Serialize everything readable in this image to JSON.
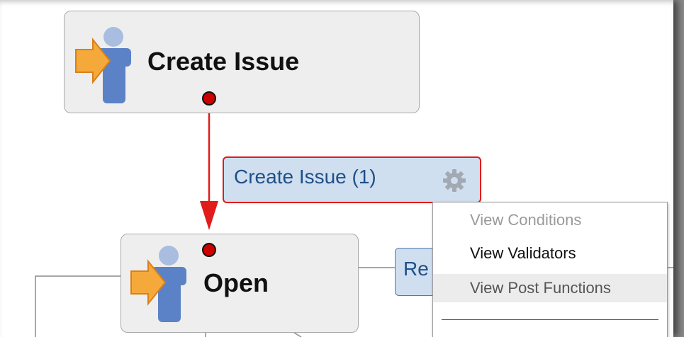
{
  "workflow": {
    "create_node": {
      "label": "Create Issue",
      "icon": "person-arrow-icon"
    },
    "open_node": {
      "label": "Open",
      "icon": "person-arrow-icon"
    },
    "transition_create": {
      "label": "Create Issue (1)",
      "icon": "gear-icon"
    },
    "transition_partial": {
      "label": "Re"
    }
  },
  "context_menu": {
    "items": [
      {
        "label": "View Conditions",
        "state": "disabled"
      },
      {
        "label": "View Validators",
        "state": "normal"
      },
      {
        "label": "View Post Functions",
        "state": "hover"
      }
    ]
  },
  "colors": {
    "arrow": "#e21b1b",
    "dot": "#cc0000",
    "transition_bg": "#cfdff0",
    "transition_text": "#1f4f87",
    "node_bg": "#eeeeee"
  }
}
